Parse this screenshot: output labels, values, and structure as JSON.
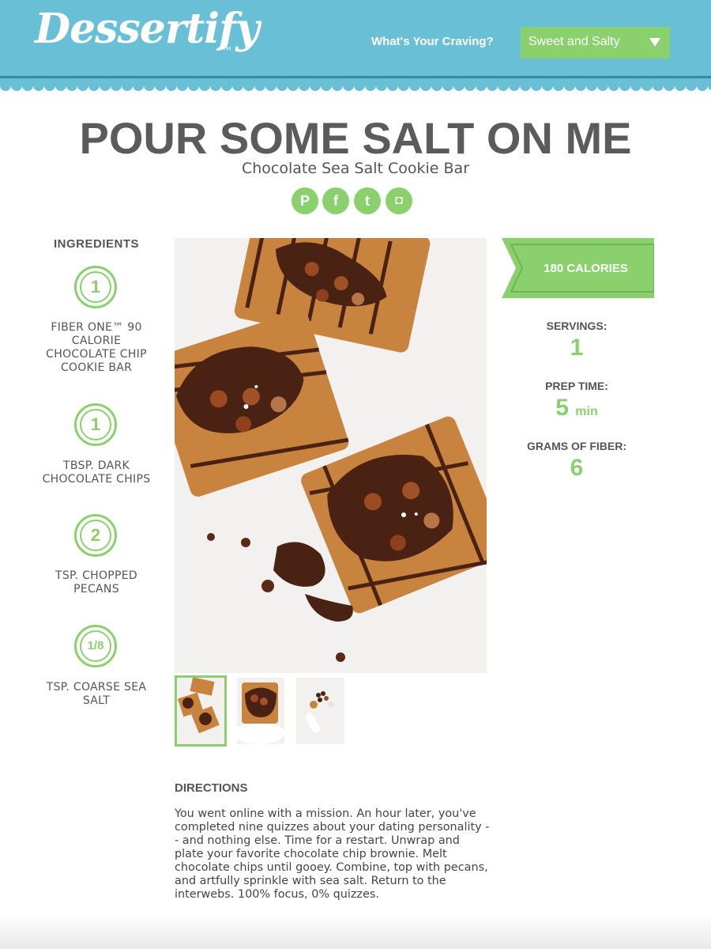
{
  "header": {
    "logo": "Dessertify",
    "logo_tm": "TM",
    "craving_label": "What's Your Craving?",
    "craving_selected": "Sweet and Salty",
    "accent_color": "#68bfd6"
  },
  "recipe": {
    "title": "POUR SOME SALT ON ME",
    "subtitle": "Chocolate Sea Salt Cookie Bar"
  },
  "social": [
    {
      "name": "pinterest",
      "glyph": "P"
    },
    {
      "name": "facebook",
      "glyph": "f"
    },
    {
      "name": "twitter",
      "glyph": "t"
    },
    {
      "name": "instagram",
      "glyph": "◘"
    }
  ],
  "ingredients": {
    "heading": "INGREDIENTS",
    "items": [
      {
        "qty": "1",
        "line1": "FIBER ONE™ 90",
        "line2": "CALORIE",
        "line3": "CHOCOLATE CHIP",
        "line4": "COOKIE BAR"
      },
      {
        "qty": "1",
        "line1": "TBSP. DARK",
        "line2": "CHOCOLATE CHIPS"
      },
      {
        "qty": "2",
        "line1": "TSP. CHOPPED",
        "line2": "PECANS"
      },
      {
        "qty": "1/8",
        "line1": "TSP. COARSE SEA",
        "line2": "SALT"
      }
    ]
  },
  "stats": {
    "calories": "180 CALORIES",
    "servings_label": "SERVINGS:",
    "servings_value": "1",
    "prep_label": "PREP TIME:",
    "prep_value": "5",
    "prep_unit": "min",
    "fiber_label": "GRAMS OF FIBER:",
    "fiber_value": "6",
    "green_color": "#8ad16e"
  },
  "directions": {
    "heading": "DIRECTIONS",
    "text": "You went online with a mission. An hour later, you've completed nine quizzes about your dating personality -- and nothing else. Time for a restart. Unwrap and plate your favorite chocolate chip brownie. Melt chocolate chips until gooey. Combine, top with pecans, and artfully sprinkle with sea salt. Return to the interwebs. 100% focus, 0% quizzes."
  }
}
